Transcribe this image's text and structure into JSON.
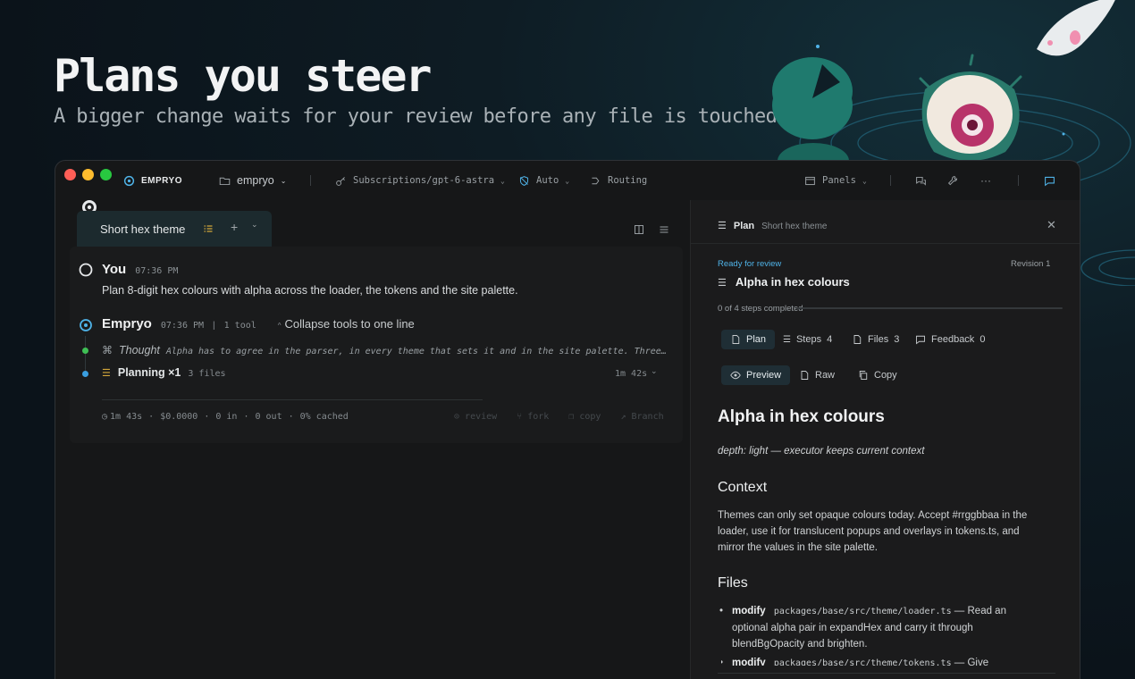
{
  "hero": {
    "title": "Plans you steer",
    "subtitle": "A bigger change waits for your review before any file is touched."
  },
  "titlebar": {
    "app_name": "EMPRYO",
    "workspace": "empryo",
    "subscription": "Subscriptions/gpt-6-astra",
    "mode": "Auto",
    "routing": "Routing",
    "panels": "Panels"
  },
  "tab": {
    "label": "Short hex theme",
    "add": "+"
  },
  "conversation": {
    "user": {
      "name": "You",
      "time": "07:36 PM",
      "message": "Plan 8-digit hex colours with alpha across the loader, the tokens and the site palette."
    },
    "assistant": {
      "name": "Empryo",
      "time": "07:36 PM",
      "divider": "|",
      "tools": "1 tool",
      "collapse": "Collapse tools to one line",
      "thought_label": "Thought",
      "thought_text": "Alpha has to agree in the parser, in every theme that sets it and in the site palette. Three…",
      "planning_label": "Planning ×1",
      "planning_files": "3 files",
      "planning_time": "1m 42s"
    },
    "footer": {
      "duration": "1m 43s",
      "cost": "$0.0000",
      "in": "0 in",
      "out": "0 out",
      "cached": "0% cached",
      "review": "review",
      "fork": "fork",
      "copy": "copy",
      "branch": "Branch"
    }
  },
  "plan_panel": {
    "header_label": "Plan",
    "header_title": "Short hex theme",
    "status": "Ready for review",
    "revision": "Revision 1",
    "plan_title": "Alpha in hex colours",
    "progress_text": "0 of 4 steps completed",
    "progress": 0,
    "tabs": [
      {
        "label": "Plan",
        "count": ""
      },
      {
        "label": "Steps",
        "count": "4"
      },
      {
        "label": "Files",
        "count": "3"
      },
      {
        "label": "Feedback",
        "count": "0"
      }
    ],
    "view_tabs": [
      "Preview",
      "Raw",
      "Copy"
    ],
    "doc": {
      "h1": "Alpha in hex colours",
      "depth": "depth: light — executor keeps current context",
      "context_heading": "Context",
      "context_body": "Themes can only set opaque colours today. Accept #rrggbbaa in the loader, use it for translucent popups and overlays in tokens.ts, and mirror the values in the site palette.",
      "files_heading": "Files",
      "files": [
        {
          "action": "modify",
          "path": "packages/base/src/theme/loader.ts",
          "desc": " — Read an optional alpha pair in expandHex and carry it through blendBgOpacity and brighten."
        },
        {
          "action": "modify",
          "path": "packages/base/src/theme/tokens.ts",
          "desc": " — Give bgPopup"
        }
      ]
    }
  },
  "colors": {
    "accent": "#4fb3e8",
    "traffic_red": "#fe5f57",
    "traffic_yellow": "#febc2e",
    "traffic_green": "#28c840",
    "step_green": "#3fbf55",
    "step_blue": "#3a9ee0"
  }
}
